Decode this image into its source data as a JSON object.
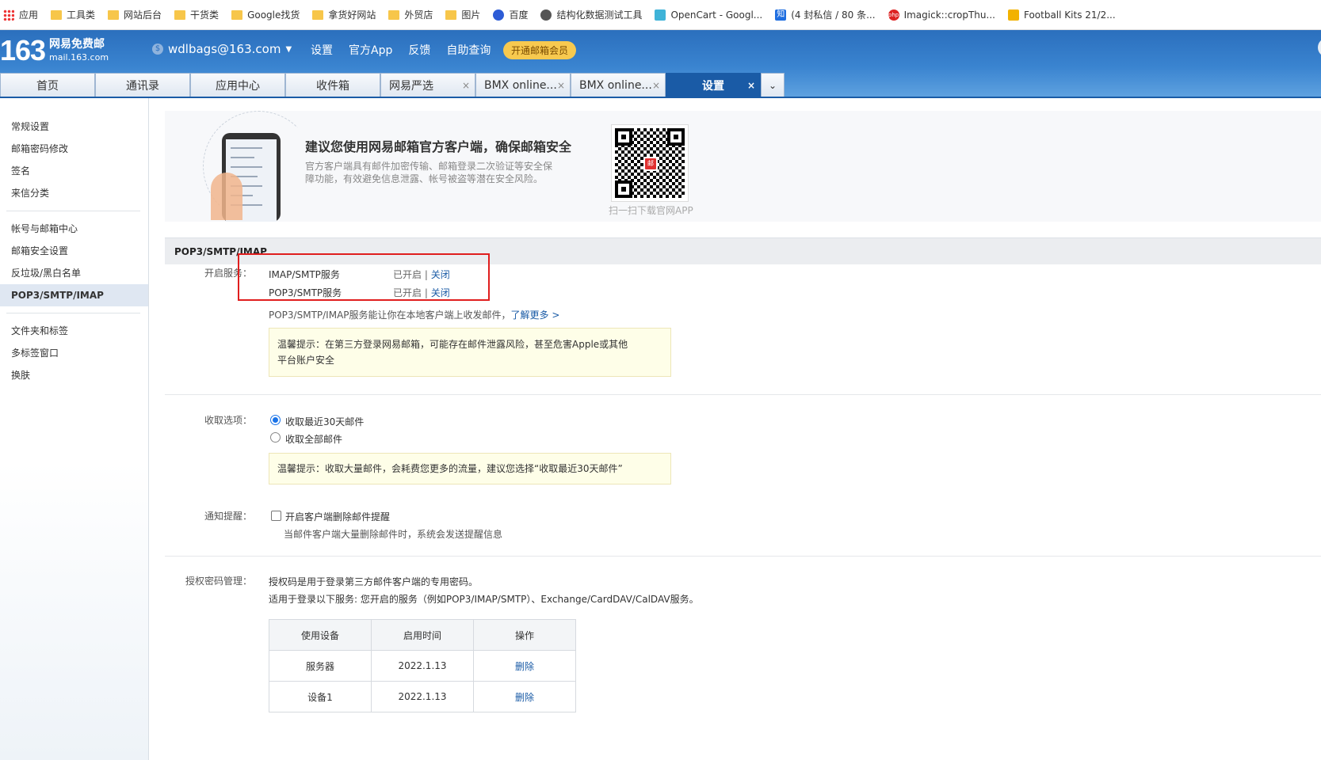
{
  "bookmarks": [
    {
      "label": "应用",
      "icon": "apps-icon"
    },
    {
      "label": "工具类",
      "icon": "folder-icon"
    },
    {
      "label": "网站后台",
      "icon": "folder-icon"
    },
    {
      "label": "干货类",
      "icon": "folder-icon"
    },
    {
      "label": "Google找货",
      "icon": "folder-icon"
    },
    {
      "label": "拿货好网站",
      "icon": "folder-icon"
    },
    {
      "label": "外贸店",
      "icon": "folder-icon"
    },
    {
      "label": "图片",
      "icon": "folder-icon"
    },
    {
      "label": "百度",
      "icon": "baidu-paw-icon"
    },
    {
      "label": "结构化数据测试工具",
      "icon": "globe-icon"
    },
    {
      "label": "OpenCart - Googl...",
      "icon": "opencart-icon"
    },
    {
      "label": "(4 封私信 / 80 条...",
      "icon": "zhihu-icon"
    },
    {
      "label": "Imagick::cropThu...",
      "icon": "php-icon"
    },
    {
      "label": "Football Kits 21/2...",
      "icon": "football-kits-icon"
    }
  ],
  "header": {
    "logo_number": "163",
    "logo_name": "网易免费邮",
    "logo_url": "mail.163.com",
    "account": "wdlbags@163.com",
    "links": [
      "设置",
      "官方App",
      "反馈",
      "自助查询"
    ],
    "vip_button": "开通邮箱会员"
  },
  "tabs": [
    {
      "label": "首页",
      "closable": false,
      "active": false
    },
    {
      "label": "通讯录",
      "closable": false,
      "active": false
    },
    {
      "label": "应用中心",
      "closable": false,
      "active": false
    },
    {
      "label": "收件箱",
      "closable": false,
      "active": false
    },
    {
      "label": "网易严选",
      "closable": true,
      "active": false
    },
    {
      "label": "BMX online...",
      "closable": true,
      "active": false
    },
    {
      "label": "BMX online...",
      "closable": true,
      "active": false
    },
    {
      "label": "设置",
      "closable": true,
      "active": true
    }
  ],
  "sidebar": {
    "group1": [
      "常规设置",
      "邮箱密码修改",
      "签名",
      "来信分类"
    ],
    "group2": [
      "帐号与邮箱中心",
      "邮箱安全设置",
      "反垃圾/黑白名单",
      "POP3/SMTP/IMAP"
    ],
    "group3": [
      "文件夹和标签",
      "多标签窗口",
      "换肤"
    ],
    "active": "POP3/SMTP/IMAP"
  },
  "promo": {
    "title": "建议您使用网易邮箱官方客户端，确保邮箱安全",
    "desc": "官方客户端具有邮件加密传输、邮箱登录二次验证等安全保障功能，有效避免信息泄露、帐号被盗等潜在安全风险。",
    "qr_caption": "扫一扫下载官网APP"
  },
  "section": {
    "title": "POP3/SMTP/IMAP",
    "service_label": "开启服务：",
    "services": [
      {
        "name": "IMAP/SMTP服务",
        "status": "已开启",
        "sep": "|",
        "action": "关闭"
      },
      {
        "name": "POP3/SMTP服务",
        "status": "已开启",
        "sep": "|",
        "action": "关闭"
      }
    ],
    "info_text": "POP3/SMTP/IMAP服务能让你在本地客户端上收发邮件，",
    "info_link": "了解更多 >",
    "tip1_line1": "温馨提示：在第三方登录网易邮箱，可能存在邮件泄露风险，甚至危害Apple或其他",
    "tip1_line2": "平台账户安全",
    "fetch_label": "收取选项：",
    "fetch_options": [
      "收取最近30天邮件",
      "收取全部邮件"
    ],
    "fetch_selected": 0,
    "tip2": "温馨提示：收取大量邮件，会耗费您更多的流量，建议您选择“收取最近30天邮件”",
    "notify_label": "通知提醒：",
    "notify_checkbox": "开启客户端删除邮件提醒",
    "notify_desc": "当邮件客户端大量删除邮件时，系统会发送提醒信息",
    "auth_label": "授权密码管理：",
    "auth_line1": "授权码是用于登录第三方邮件客户端的专用密码。",
    "auth_line2": "适用于登录以下服务: 您开启的服务（例如POP3/IMAP/SMTP）、Exchange/CardDAV/CalDAV服务。",
    "table_headers": [
      "使用设备",
      "启用时间",
      "操作"
    ],
    "table_rows": [
      {
        "device": "服务器",
        "date": "2022.1.13",
        "action": "删除"
      },
      {
        "device": "设备1",
        "date": "2022.1.13",
        "action": "删除"
      }
    ]
  },
  "colors": {
    "header_blue": "#2b6fbd",
    "active_tab": "#1a5ba6",
    "link": "#1a5ba6",
    "highlight_border": "#e01e1e",
    "vip": "#f7c94f"
  }
}
